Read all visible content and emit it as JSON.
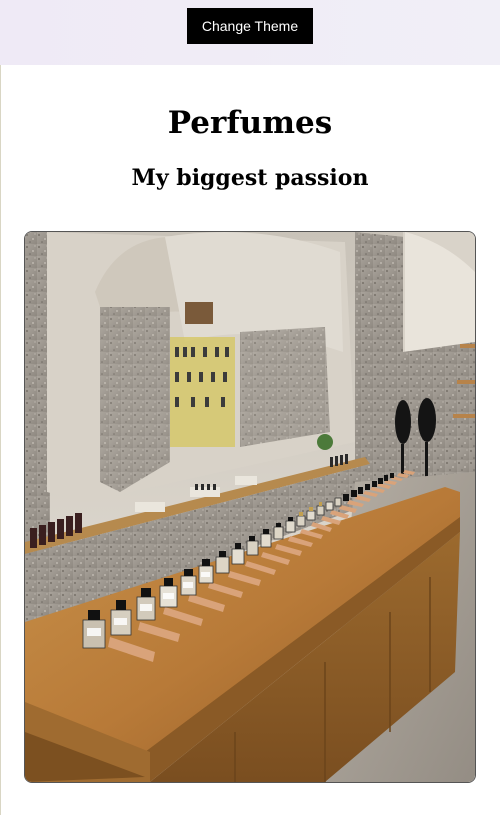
{
  "header": {
    "theme_button_label": "Change Theme"
  },
  "main": {
    "title": "Perfumes",
    "subtitle": "My biggest passion"
  }
}
